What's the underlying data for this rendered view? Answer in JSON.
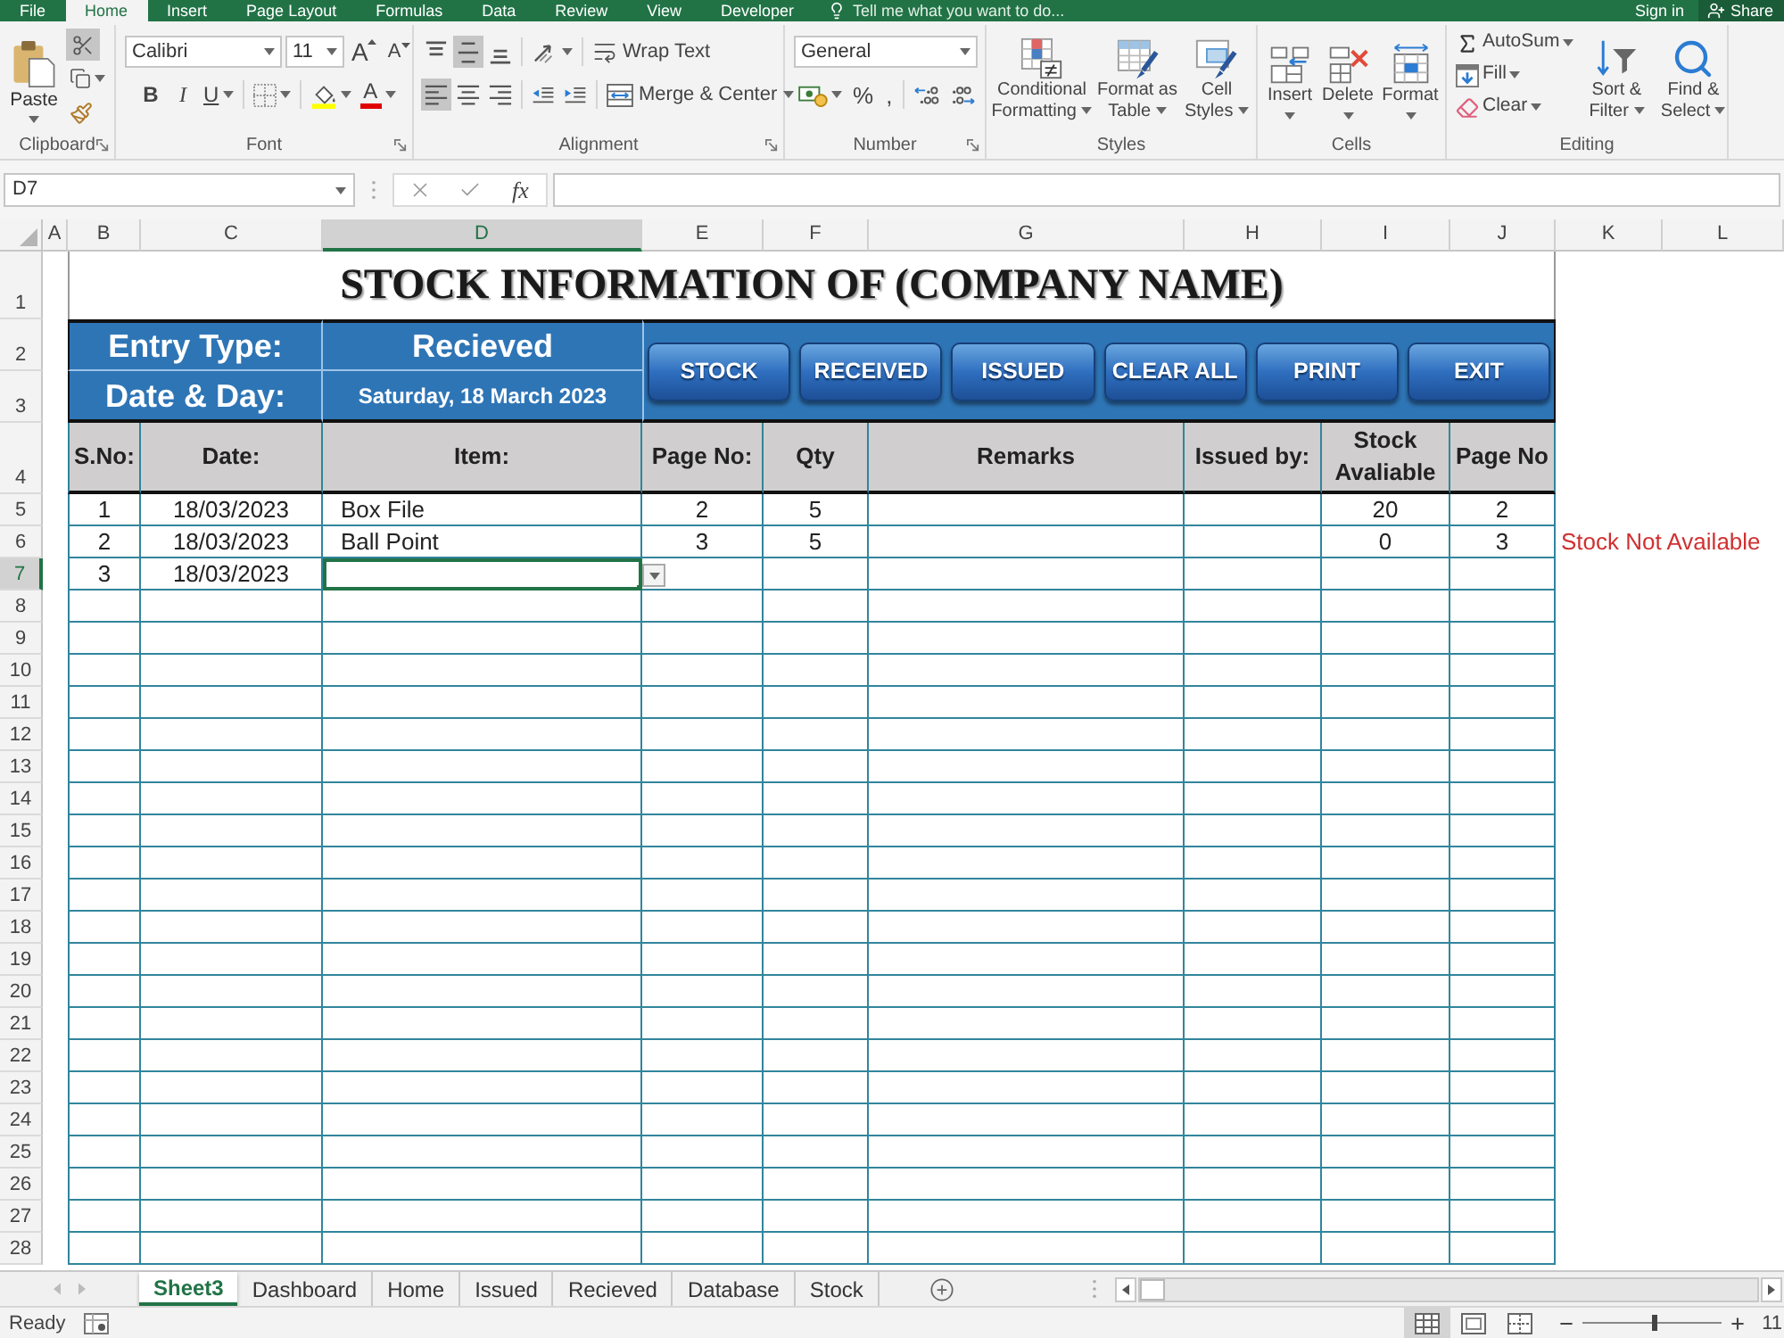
{
  "ribbon_tabs": [
    {
      "label": "File",
      "selected": false
    },
    {
      "label": "Home",
      "selected": true
    },
    {
      "label": "Insert",
      "selected": false
    },
    {
      "label": "Page Layout",
      "selected": false
    },
    {
      "label": "Formulas",
      "selected": false
    },
    {
      "label": "Data",
      "selected": false
    },
    {
      "label": "Review",
      "selected": false
    },
    {
      "label": "View",
      "selected": false
    },
    {
      "label": "Developer",
      "selected": false
    }
  ],
  "tell_me": {
    "placeholder": "Tell me what you want to do..."
  },
  "account": {
    "sign_in": "Sign in",
    "share": "Share"
  },
  "ribbon": {
    "clipboard": {
      "label": "Clipboard",
      "paste": "Paste",
      "cut_active": true
    },
    "font": {
      "label": "Font",
      "font_name": "Calibri",
      "font_size": "11",
      "grow_font": "A",
      "shrink_font": "A",
      "bold": "B",
      "italic": "I",
      "underline": "U",
      "font_color": "A"
    },
    "alignment": {
      "label": "Alignment",
      "vertical_align": [
        {
          "kind": "top",
          "selected": false
        },
        {
          "kind": "middle",
          "selected": true
        },
        {
          "kind": "bottom",
          "selected": false
        }
      ],
      "horizontal_align": [
        {
          "kind": "left",
          "selected": true
        },
        {
          "kind": "center",
          "selected": false
        },
        {
          "kind": "right",
          "selected": false
        }
      ],
      "wrap_text": "Wrap Text",
      "merge": "Merge & Center"
    },
    "number": {
      "label": "Number",
      "format": "General",
      "percent": "%",
      "comma": ","
    },
    "styles": {
      "label": "Styles",
      "buttons": [
        "Conditional Formatting",
        "Format as Table",
        "Cell Styles"
      ]
    },
    "cells": {
      "label": "Cells",
      "buttons": [
        "Insert",
        "Delete",
        "Format"
      ]
    },
    "editing": {
      "label": "Editing",
      "autosum": "AutoSum",
      "fill": "Fill",
      "clear": "Clear",
      "sort": "Sort & Filter",
      "find": "Find & Select"
    }
  },
  "formula_bar": {
    "name_box": "D7",
    "function": "fx"
  },
  "column_headers": [
    {
      "label": "A",
      "selected": false
    },
    {
      "label": "B",
      "selected": false
    },
    {
      "label": "C",
      "selected": false
    },
    {
      "label": "D",
      "selected": true
    },
    {
      "label": "E",
      "selected": false
    },
    {
      "label": "F",
      "selected": false
    },
    {
      "label": "G",
      "selected": false
    },
    {
      "label": "H",
      "selected": false
    },
    {
      "label": "I",
      "selected": false
    },
    {
      "label": "J",
      "selected": false
    },
    {
      "label": "K",
      "selected": false
    },
    {
      "label": "L",
      "selected": false
    }
  ],
  "row_headers": [
    {
      "label": "1",
      "selected": false
    },
    {
      "label": "2",
      "selected": false
    },
    {
      "label": "3",
      "selected": false
    },
    {
      "label": "4",
      "selected": false
    },
    {
      "label": "5",
      "selected": false
    },
    {
      "label": "6",
      "selected": false
    },
    {
      "label": "7",
      "selected": true
    },
    {
      "label": "8",
      "selected": false
    },
    {
      "label": "9",
      "selected": false
    },
    {
      "label": "10",
      "selected": false
    },
    {
      "label": "11",
      "selected": false
    },
    {
      "label": "12",
      "selected": false
    },
    {
      "label": "13",
      "selected": false
    },
    {
      "label": "14",
      "selected": false
    },
    {
      "label": "15",
      "selected": false
    },
    {
      "label": "16",
      "selected": false
    },
    {
      "label": "17",
      "selected": false
    },
    {
      "label": "18",
      "selected": false
    },
    {
      "label": "19",
      "selected": false
    },
    {
      "label": "20",
      "selected": false
    },
    {
      "label": "21",
      "selected": false
    },
    {
      "label": "22",
      "selected": false
    },
    {
      "label": "23",
      "selected": false
    },
    {
      "label": "24",
      "selected": false
    },
    {
      "label": "25",
      "selected": false
    },
    {
      "label": "26",
      "selected": false
    },
    {
      "label": "27",
      "selected": false
    },
    {
      "label": "28",
      "selected": false
    }
  ],
  "sheet": {
    "title": "STOCK INFORMATION OF (COMPANY NAME)",
    "entry_type": {
      "label": "Entry Type:",
      "value": "Recieved"
    },
    "date_day": {
      "label": "Date & Day:",
      "value": "Saturday, 18 March 2023"
    },
    "buttons": [
      "STOCK",
      "RECEIVED",
      "ISSUED",
      "CLEAR ALL",
      "PRINT",
      "EXIT"
    ],
    "columns": [
      "S.No:",
      "Date:",
      "Item:",
      "Page No:",
      "Qty",
      "Remarks",
      "Issued by:",
      "Stock Avaliable",
      "Page No"
    ],
    "rows": [
      {
        "cells": [
          "1",
          "18/03/2023",
          "Box File",
          "2",
          "5",
          null,
          null,
          "20",
          "2"
        ],
        "selected": false
      },
      {
        "cells": [
          "2",
          "18/03/2023",
          "Ball Point",
          "3",
          "5",
          null,
          null,
          "0",
          "3"
        ],
        "note": "Stock Not Available",
        "selected": false
      },
      {
        "cells": [
          "3",
          "18/03/2023",
          null,
          null,
          null,
          null,
          null,
          null,
          null
        ],
        "selected": true
      }
    ]
  },
  "sheet_tabs": [
    {
      "label": "Sheet3",
      "selected": true
    },
    {
      "label": "Dashboard",
      "selected": false
    },
    {
      "label": "Home",
      "selected": false
    },
    {
      "label": "Issued",
      "selected": false
    },
    {
      "label": "Recieved",
      "selected": false
    },
    {
      "label": "Database",
      "selected": false
    },
    {
      "label": "Stock",
      "selected": false
    }
  ],
  "status_bar": {
    "status": "Ready",
    "views": [
      {
        "kind": "normal",
        "selected": true
      },
      {
        "kind": "page_layout",
        "selected": false
      },
      {
        "kind": "page_break",
        "selected": false
      }
    ],
    "zoom": {
      "level": 0.52,
      "reading": "11"
    }
  }
}
